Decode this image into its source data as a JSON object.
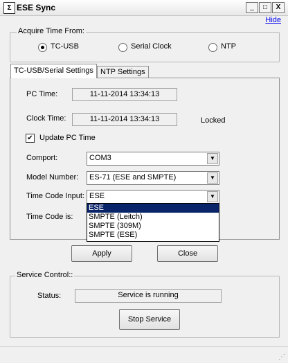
{
  "window": {
    "title": "ESE Sync",
    "icon": "app-logo-icon",
    "hide_link": "Hide",
    "minimize": "_",
    "maximize": "□",
    "close": "X"
  },
  "acquire": {
    "title": "Acquire Time From:",
    "options": [
      {
        "label": "TC-USB",
        "checked": true
      },
      {
        "label": "Serial Clock",
        "checked": false
      },
      {
        "label": "NTP",
        "checked": false
      }
    ]
  },
  "tabs": [
    {
      "label": "TC-USB/Serial Settings",
      "active": true
    },
    {
      "label": "NTP Settings",
      "active": false
    }
  ],
  "settings": {
    "pc_time_label": "PC Time:",
    "pc_time_value": "11-11-2014  13:34:13",
    "clock_time_label": "Clock Time:",
    "clock_time_value": "11-11-2014  13:34:13",
    "lock_status": "Locked",
    "update_pc_time_label": "Update PC Time",
    "update_pc_time_checked": true,
    "check_mark": "✔",
    "comport_label": "Comport:",
    "comport_value": "COM3",
    "model_label": "Model Number:",
    "model_value": "ES-71 (ESE and SMPTE)",
    "timecode_input_label": "Time Code Input:",
    "timecode_input_value": "ESE",
    "timecode_label": "Time Code is:",
    "timecode_options": [
      "ESE",
      "SMPTE (Leitch)",
      "SMPTE (309M)",
      "SMPTE (ESE)"
    ],
    "dropdown_arrow": "▼"
  },
  "buttons": {
    "apply": "Apply",
    "close": "Close"
  },
  "service": {
    "title": "Service Control::",
    "status_label": "Status:",
    "status_value": "Service is running",
    "stop_button": "Stop Service"
  },
  "statusbar": {
    "grip": "⋰"
  }
}
